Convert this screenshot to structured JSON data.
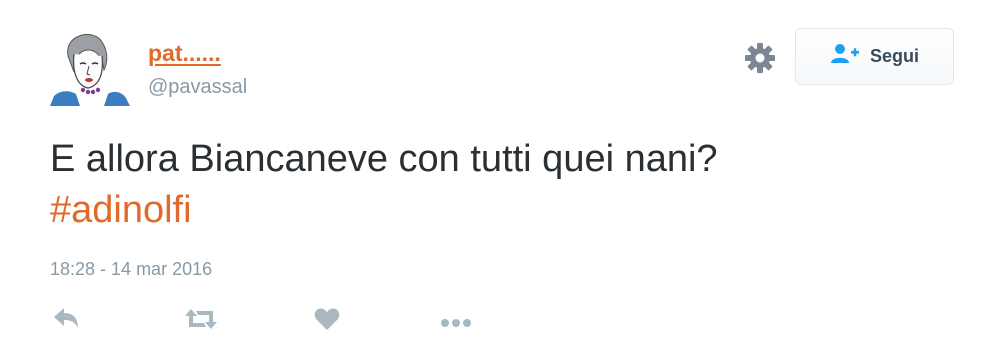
{
  "author": {
    "display_name": "pat......",
    "handle": "@pavassal",
    "avatar_icon": "portrait-drawing-avatar"
  },
  "follow_button": {
    "label": "Segui",
    "icon": "add-user-icon",
    "icon_color": "#1da1f2"
  },
  "settings_icon": "gear-icon",
  "tweet": {
    "text": "E allora Biancaneve con tutti quei nani?",
    "hashtag": "#adinolfi",
    "timestamp": "18:28 - 14 mar 2016"
  },
  "actions": [
    "reply-icon",
    "retweet-icon",
    "like-icon",
    "more-icon"
  ],
  "colors": {
    "accent": "#e0692b",
    "text": "#292f33",
    "muted": "#8899a6",
    "icon": "#aab8c2"
  }
}
